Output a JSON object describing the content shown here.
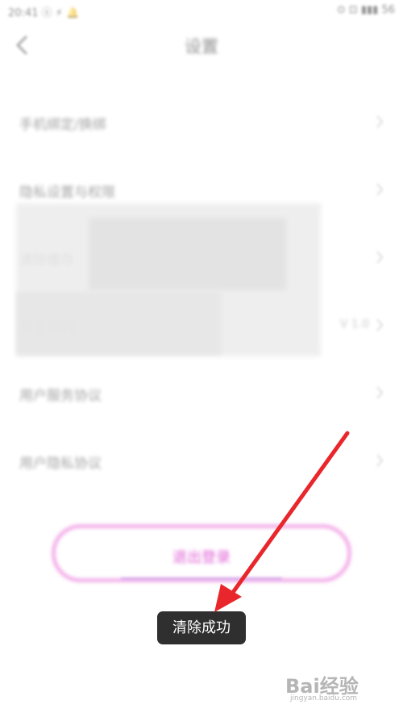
{
  "status_bar": {
    "left": "20:41 ⓢ ⚡ 🔔",
    "right": "⊙ ⊡ ▮▮▮ 56"
  },
  "header": {
    "title": "设置",
    "back_icon": "back-chevron-icon"
  },
  "settings": {
    "items": [
      {
        "label": "手机绑定/换绑",
        "value": "",
        "icon": "chevron-right-icon"
      },
      {
        "label": "隐私设置与权限",
        "value": "",
        "icon": "chevron-right-icon"
      },
      {
        "label": "清除缓存",
        "value": "",
        "icon": "chevron-right-icon"
      },
      {
        "label": "关于我们",
        "value": "V 1.0",
        "icon": "chevron-right-icon"
      },
      {
        "label": "用户服务协议",
        "value": "",
        "icon": "chevron-right-icon"
      },
      {
        "label": "用户隐私协议",
        "value": "",
        "icon": "chevron-right-icon"
      }
    ]
  },
  "logout": {
    "label": "退出登录"
  },
  "toast": {
    "message": "清除成功"
  },
  "annotation": {
    "arrow_color": "#e8262b"
  },
  "watermark": {
    "logo_text": "Bai经验",
    "domain": "jingyan.baidu.com"
  },
  "colors": {
    "accent_pink": "#e060d6",
    "button_border": "#f4b2ea",
    "toast_bg": "#2f2f2f",
    "arrow_red": "#e8262b"
  }
}
